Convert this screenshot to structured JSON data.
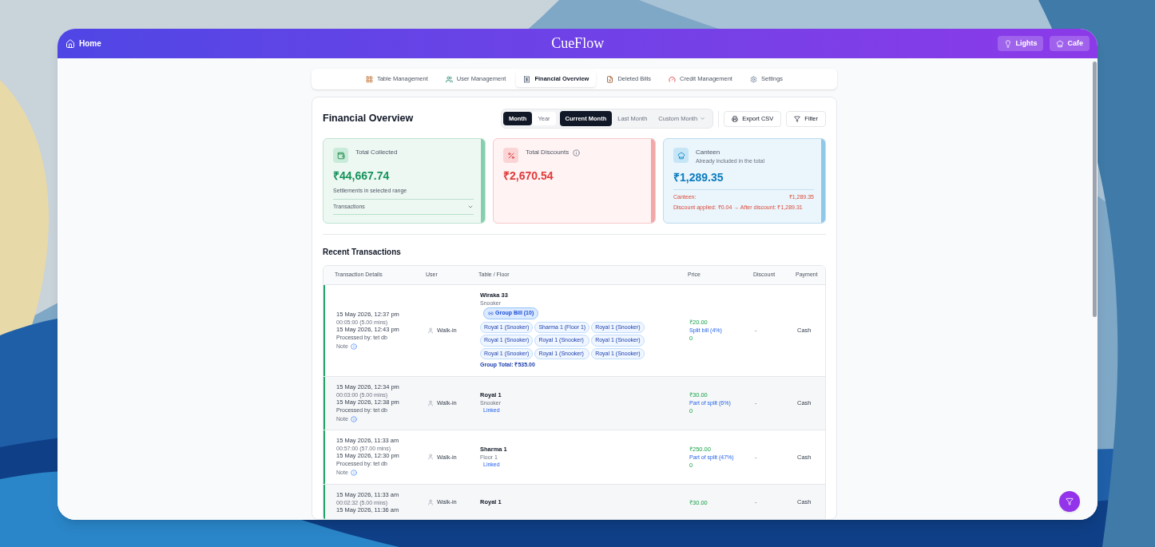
{
  "header": {
    "home": "Home",
    "logo": "CueFlow",
    "actions": [
      "Lights",
      "Cafe"
    ]
  },
  "nav_tabs": [
    {
      "label": "Table Management",
      "selected": false,
      "kind": "table"
    },
    {
      "label": "User Management",
      "selected": false,
      "kind": "users"
    },
    {
      "label": "Financial Overview",
      "selected": true,
      "kind": "finance"
    },
    {
      "label": "Deleted Bills",
      "selected": false,
      "kind": "deleted"
    },
    {
      "label": "Credit Management",
      "selected": false,
      "kind": "credit"
    },
    {
      "label": "Settings",
      "selected": false,
      "kind": "settings"
    }
  ],
  "title": "Financial Overview",
  "period_toggle": [
    {
      "label": "Month",
      "selected": true
    },
    {
      "label": "Year",
      "selected": false
    }
  ],
  "range_toggle": [
    {
      "label": "Current Month",
      "selected": true
    },
    {
      "label": "Last Month",
      "selected": false
    },
    {
      "label": "Custom Month",
      "selected": false,
      "dropdown": true
    }
  ],
  "buttons": [
    {
      "label": "Export CSV",
      "kind": "print"
    },
    {
      "label": "Filter",
      "kind": "filter"
    }
  ],
  "cards": [
    {
      "kind": "collected",
      "title": "Total Collected",
      "amount": "₹44,667.74",
      "note": "Settlements in selected range",
      "expander": "Transactions"
    },
    {
      "kind": "discounts",
      "title": "Total Discounts",
      "amount": "₹2,670.54",
      "info": true
    },
    {
      "kind": "canteen",
      "title": "Canteen",
      "subtitle": "Already included in the total",
      "amount": "₹1,289.35",
      "line_label": "Canteen:",
      "line_value": "₹1,289.35",
      "discount_line": "Discount applied: ₹0.04 → After discount: ₹1,289.31"
    }
  ],
  "recent": {
    "title": "Recent Transactions",
    "columns": [
      "Transaction Details",
      "User",
      "Table / Floor",
      "Price",
      "Discount",
      "Payment"
    ],
    "rows": [
      {
        "start": "15 May 2026, 12:37 pm",
        "duration": "00:05:00 (5.00 mins)",
        "end": "15 May 2026, 12:43 pm",
        "processed": "Processed by: tet db",
        "note": "Note",
        "user": "Walk-in",
        "table": "Wiraka 33",
        "floor": "Snooker",
        "group_bill": "Group Bill (10)",
        "members": [
          "Royal 1 (Snooker)",
          "Sharma 1 (Floor 1)",
          "Royal 1 (Snooker)",
          "Royal 1 (Snooker)",
          "Royal 1 (Snooker)",
          "Royal 1 (Snooker)",
          "Royal 1 (Snooker)",
          "Royal 1 (Snooker)",
          "Royal 1 (Snooker)"
        ],
        "group_total": "Group Total: ₹535.00",
        "price": "₹20.00",
        "split": "Split bill (4%)",
        "price_sub": "0",
        "discount": "-",
        "payment": "Cash"
      },
      {
        "start": "15 May 2026, 12:34 pm",
        "duration": "00:03:00 (5.00 mins)",
        "end": "15 May 2026, 12:38 pm",
        "processed": "Processed by: tet db",
        "note": "Note",
        "user": "Walk-in",
        "table": "Royal 1",
        "floor": "Snooker",
        "linked": "Linked",
        "price": "₹30.00",
        "split": "Part of split (6%)",
        "price_sub": "0",
        "discount": "-",
        "payment": "Cash"
      },
      {
        "start": "15 May 2026, 11:33 am",
        "duration": "00:57:00 (57.00 mins)",
        "end": "15 May 2026, 12:30 pm",
        "processed": "Processed by: tet db",
        "note": "Note",
        "user": "Walk-in",
        "table": "Sharma 1",
        "floor": "Floor 1",
        "linked": "Linked",
        "price": "₹250.00",
        "split": "Part of split (47%)",
        "price_sub": "0",
        "discount": "-",
        "payment": "Cash"
      },
      {
        "start": "15 May 2026, 11:33 am",
        "duration": "00:02:32 (5.00 mins)",
        "end": "15 May 2026, 11:36 am",
        "user": "Walk-in",
        "table": "Royal 1",
        "price": "₹30.00",
        "discount": "-",
        "payment": "Cash"
      }
    ]
  }
}
